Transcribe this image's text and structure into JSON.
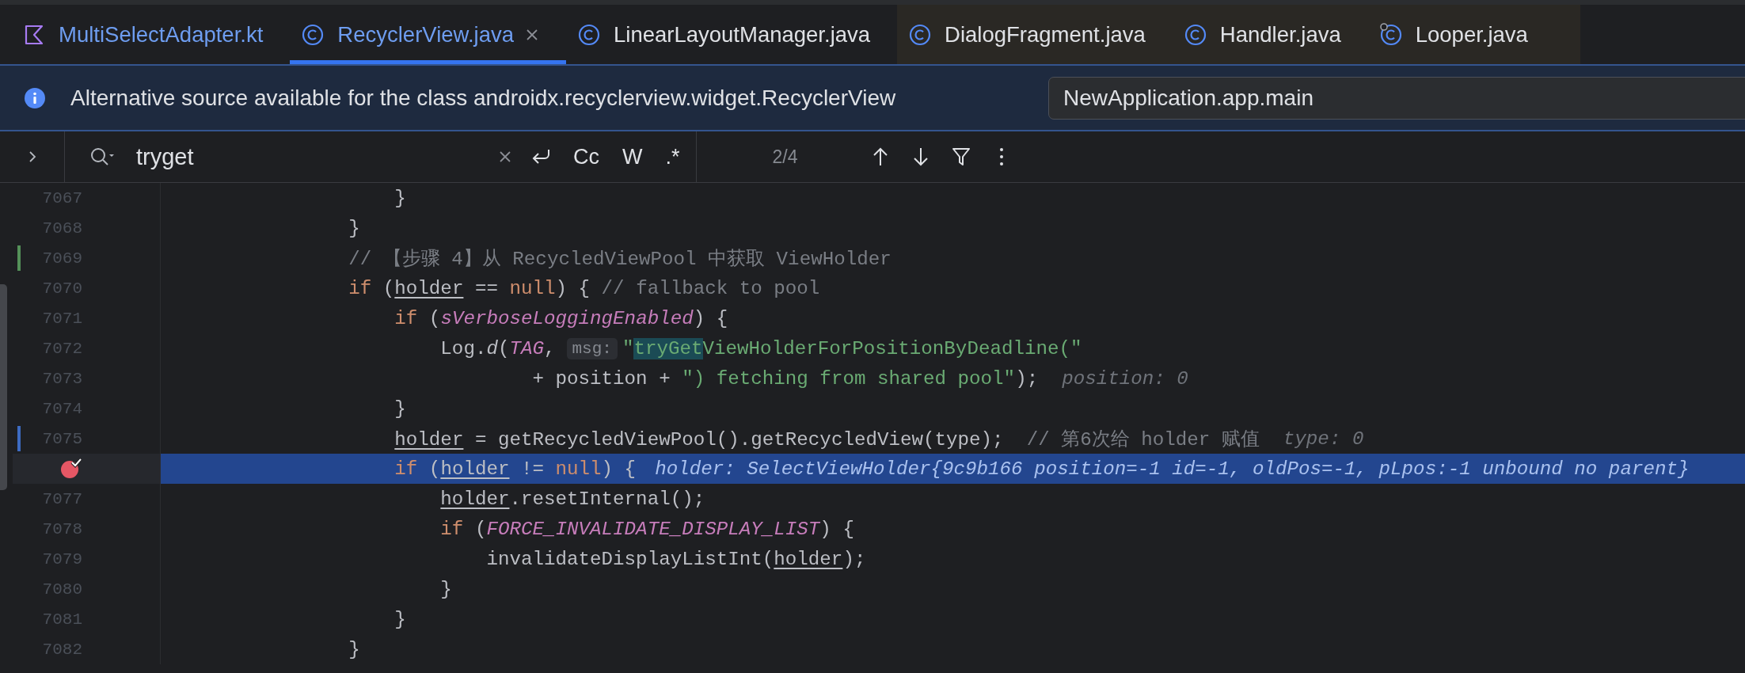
{
  "tabs": [
    {
      "label": "MultiSelectAdapter.kt",
      "kind": "kotlin",
      "selected": false,
      "modified": true,
      "non_project": false
    },
    {
      "label": "RecyclerView.java",
      "kind": "class",
      "selected": true,
      "modified": true,
      "non_project": false
    },
    {
      "label": "LinearLayoutManager.java",
      "kind": "class",
      "selected": false,
      "modified": false,
      "non_project": false
    },
    {
      "label": "DialogFragment.java",
      "kind": "class",
      "selected": false,
      "modified": false,
      "non_project": true
    },
    {
      "label": "Handler.java",
      "kind": "class",
      "selected": false,
      "modified": false,
      "non_project": true
    },
    {
      "label": "Looper.java",
      "kind": "linked",
      "selected": false,
      "modified": false,
      "non_project": true
    }
  ],
  "notification": {
    "message": "Alternative source available for the class androidx.recyclerview.widget.RecyclerView",
    "module": "NewApplication.app.main"
  },
  "search": {
    "query": "tryget",
    "options": [
      "Cc",
      "W",
      ".*"
    ],
    "match_count": "2/4"
  },
  "editor": {
    "lines": [
      {
        "number": "7067",
        "added": false,
        "modified": false,
        "breakpoint": false,
        "current": false,
        "segments": [
          {
            "kind": "plain",
            "text": "                    }"
          }
        ]
      },
      {
        "number": "7068",
        "added": false,
        "modified": false,
        "breakpoint": false,
        "current": false,
        "segments": [
          {
            "kind": "plain",
            "text": "                }"
          }
        ]
      },
      {
        "number": "7069",
        "added": true,
        "modified": false,
        "breakpoint": false,
        "current": false,
        "segments": [
          {
            "kind": "comment",
            "text": "                // 【步骤 4】从 RecycledViewPool 中获取 ViewHolder"
          }
        ]
      },
      {
        "number": "7070",
        "added": false,
        "modified": false,
        "breakpoint": false,
        "current": false,
        "segments": [
          {
            "kind": "keyword",
            "text": "                if"
          },
          {
            "kind": "plain",
            "text": " ("
          },
          {
            "kind": "variable",
            "text": "holder"
          },
          {
            "kind": "plain",
            "text": " == "
          },
          {
            "kind": "keyword",
            "text": "null"
          },
          {
            "kind": "plain",
            "text": ") { "
          },
          {
            "kind": "comment",
            "text": "// fallback to pool"
          }
        ]
      },
      {
        "number": "7071",
        "added": false,
        "modified": false,
        "breakpoint": false,
        "current": false,
        "segments": [
          {
            "kind": "keyword",
            "text": "                    if"
          },
          {
            "kind": "plain",
            "text": " ("
          },
          {
            "kind": "constant",
            "text": "sVerboseLoggingEnabled"
          },
          {
            "kind": "plain",
            "text": ") {"
          }
        ]
      },
      {
        "number": "7072",
        "added": false,
        "modified": false,
        "breakpoint": false,
        "current": false,
        "segments": [
          {
            "kind": "plain",
            "text": "                        Log."
          },
          {
            "kind": "method",
            "text": "d"
          },
          {
            "kind": "plain",
            "text": "("
          },
          {
            "kind": "constant",
            "text": "TAG"
          },
          {
            "kind": "plain",
            "text": ","
          },
          {
            "kind": "hint",
            "text": "msg:"
          },
          {
            "kind": "string",
            "text": "\""
          },
          {
            "kind": "match",
            "text": "tryGet"
          },
          {
            "kind": "string",
            "text": "ViewHolderForPositionByDeadline(\""
          }
        ]
      },
      {
        "number": "7073",
        "added": false,
        "modified": false,
        "breakpoint": false,
        "current": false,
        "segments": [
          {
            "kind": "plain",
            "text": "                                + position + "
          },
          {
            "kind": "string",
            "text": "\") fetching from shared pool\""
          },
          {
            "kind": "plain",
            "text": ");"
          },
          {
            "kind": "value",
            "text": "position: 0"
          }
        ]
      },
      {
        "number": "7074",
        "added": false,
        "modified": false,
        "breakpoint": false,
        "current": false,
        "segments": [
          {
            "kind": "plain",
            "text": "                    }"
          }
        ]
      },
      {
        "number": "7075",
        "added": false,
        "modified": true,
        "breakpoint": false,
        "current": false,
        "segments": [
          {
            "kind": "variable",
            "text": "                    holder"
          },
          {
            "kind": "plain",
            "text": " = getRecycledViewPool().getRecycledView(type);  "
          },
          {
            "kind": "comment",
            "text": "// 第6次给 holder 赋值"
          },
          {
            "kind": "value",
            "text": "type: 0"
          }
        ]
      },
      {
        "added": false,
        "modified": false,
        "breakpoint": true,
        "current": true,
        "segments": [
          {
            "kind": "keyword",
            "text": "                    if"
          },
          {
            "kind": "plain",
            "text": " ("
          },
          {
            "kind": "variable",
            "text": "holder"
          },
          {
            "kind": "plain",
            "text": " != "
          },
          {
            "kind": "keyword",
            "text": "null"
          },
          {
            "kind": "plain",
            "text": ") {"
          },
          {
            "kind": "value",
            "text": "holder: SelectViewHolder{9c9b166 position=-1 id=-1, oldPos=-1, pLpos:-1 unbound no parent}"
          }
        ]
      },
      {
        "number": "7077",
        "added": false,
        "modified": false,
        "breakpoint": false,
        "current": false,
        "segments": [
          {
            "kind": "variable",
            "text": "                        holder"
          },
          {
            "kind": "plain",
            "text": ".resetInternal();"
          }
        ]
      },
      {
        "number": "7078",
        "added": false,
        "modified": false,
        "breakpoint": false,
        "current": false,
        "segments": [
          {
            "kind": "keyword",
            "text": "                        if"
          },
          {
            "kind": "plain",
            "text": " ("
          },
          {
            "kind": "constant",
            "text": "FORCE_INVALIDATE_DISPLAY_LIST"
          },
          {
            "kind": "plain",
            "text": ") {"
          }
        ]
      },
      {
        "number": "7079",
        "added": false,
        "modified": false,
        "breakpoint": false,
        "current": false,
        "segments": [
          {
            "kind": "plain",
            "text": "                            invalidateDisplayListInt("
          },
          {
            "kind": "variable",
            "text": "holder"
          },
          {
            "kind": "plain",
            "text": ");"
          }
        ]
      },
      {
        "number": "7080",
        "added": false,
        "modified": false,
        "breakpoint": false,
        "current": false,
        "segments": [
          {
            "kind": "plain",
            "text": "                        }"
          }
        ]
      },
      {
        "number": "7081",
        "added": false,
        "modified": false,
        "breakpoint": false,
        "current": false,
        "segments": [
          {
            "kind": "plain",
            "text": "                    }"
          }
        ]
      },
      {
        "number": "7082",
        "added": false,
        "modified": false,
        "breakpoint": false,
        "current": false,
        "segments": [
          {
            "kind": "plain",
            "text": "                }"
          }
        ]
      }
    ]
  }
}
